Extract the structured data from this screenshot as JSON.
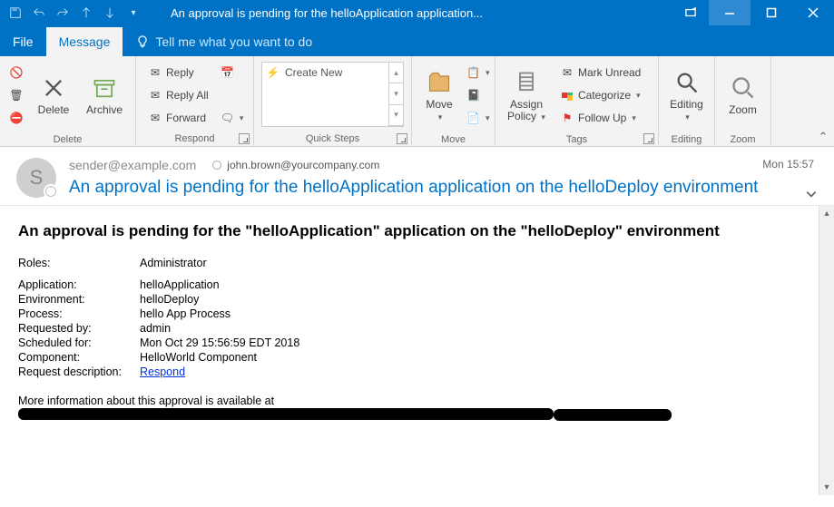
{
  "titlebar": {
    "title": "An approval is pending for the helloApplication application..."
  },
  "menubar": {
    "file": "File",
    "message": "Message",
    "tell_me": "Tell me what you want to do"
  },
  "ribbon": {
    "delete_group": {
      "label": "Delete",
      "delete": "Delete",
      "archive": "Archive"
    },
    "respond_group": {
      "label": "Respond",
      "reply": "Reply",
      "reply_all": "Reply All",
      "forward": "Forward"
    },
    "quick_steps_group": {
      "label": "Quick Steps",
      "create_new": "Create New"
    },
    "move_group": {
      "label": "Move",
      "move": "Move"
    },
    "tags_group": {
      "label": "Tags",
      "assign_policy": "Assign Policy",
      "mark_unread": "Mark Unread",
      "categorize": "Categorize",
      "follow_up": "Follow Up"
    },
    "editing_group": {
      "label": "Editing",
      "editing": "Editing"
    },
    "zoom_group": {
      "label": "Zoom",
      "zoom": "Zoom"
    }
  },
  "message_header": {
    "avatar_initial": "S",
    "from": "sender@example.com",
    "to": "john.brown@yourcompany.com",
    "date": "Mon 15:57",
    "subject": "An approval is pending for the helloApplication application on the helloDeploy environment"
  },
  "body": {
    "heading": "An approval is pending for the \"helloApplication\" application on the \"helloDeploy\" environment",
    "rows": {
      "roles_k": "Roles:",
      "roles_v": "Administrator",
      "app_k": "Application:",
      "app_v": "helloApplication",
      "env_k": "Environment:",
      "env_v": "helloDeploy",
      "proc_k": "Process:",
      "proc_v": "hello App Process",
      "req_k": "Requested by:",
      "req_v": "admin",
      "sched_k": "Scheduled for:",
      "sched_v": "Mon Oct 29 15:56:59 EDT 2018",
      "comp_k": "Component:",
      "comp_v": "HelloWorld Component",
      "desc_k": "Request description:",
      "respond": "Respond"
    },
    "more_info": "More information about this approval is available at "
  }
}
